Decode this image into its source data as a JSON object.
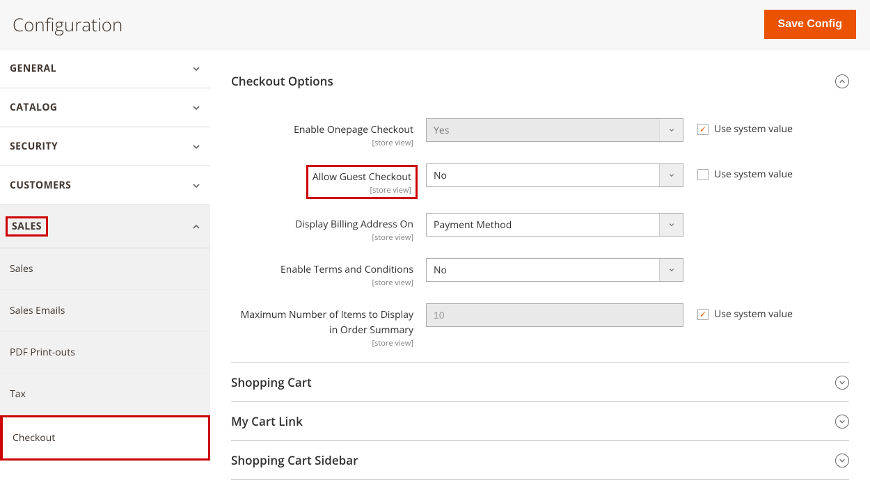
{
  "header": {
    "title": "Configuration",
    "save_label": "Save Config"
  },
  "sidebar": {
    "groups": [
      {
        "label": "GENERAL",
        "expanded": false
      },
      {
        "label": "CATALOG",
        "expanded": false
      },
      {
        "label": "SECURITY",
        "expanded": false
      },
      {
        "label": "CUSTOMERS",
        "expanded": false
      },
      {
        "label": "SALES",
        "expanded": true,
        "highlight": true,
        "items": [
          {
            "label": "Sales"
          },
          {
            "label": "Sales Emails"
          },
          {
            "label": "PDF Print-outs"
          },
          {
            "label": "Tax"
          },
          {
            "label": "Checkout",
            "active": true,
            "highlight": true
          }
        ]
      }
    ]
  },
  "sections": {
    "checkout_options": {
      "title": "Checkout Options",
      "expanded": true,
      "fields": {
        "onepage": {
          "label": "Enable Onepage Checkout",
          "scope": "[store view]",
          "value": "Yes",
          "disabled": true,
          "use_system_label": "Use system value",
          "use_system_checked": true
        },
        "guest": {
          "label": "Allow Guest Checkout",
          "scope": "[store view]",
          "value": "No",
          "highlight": true,
          "use_system_label": "Use system value",
          "use_system_checked": false
        },
        "billing": {
          "label": "Display Billing Address On",
          "scope": "[store view]",
          "value": "Payment Method"
        },
        "terms": {
          "label": "Enable Terms and Conditions",
          "scope": "[store view]",
          "value": "No"
        },
        "max_items": {
          "label": "Maximum Number of Items to Display in Order Summary",
          "scope": "[store view]",
          "value": "10",
          "disabled": true,
          "use_system_label": "Use system value",
          "use_system_checked": true
        }
      }
    },
    "shopping_cart": {
      "title": "Shopping Cart",
      "expanded": false
    },
    "my_cart_link": {
      "title": "My Cart Link",
      "expanded": false
    },
    "cart_sidebar": {
      "title": "Shopping Cart Sidebar",
      "expanded": false
    }
  }
}
